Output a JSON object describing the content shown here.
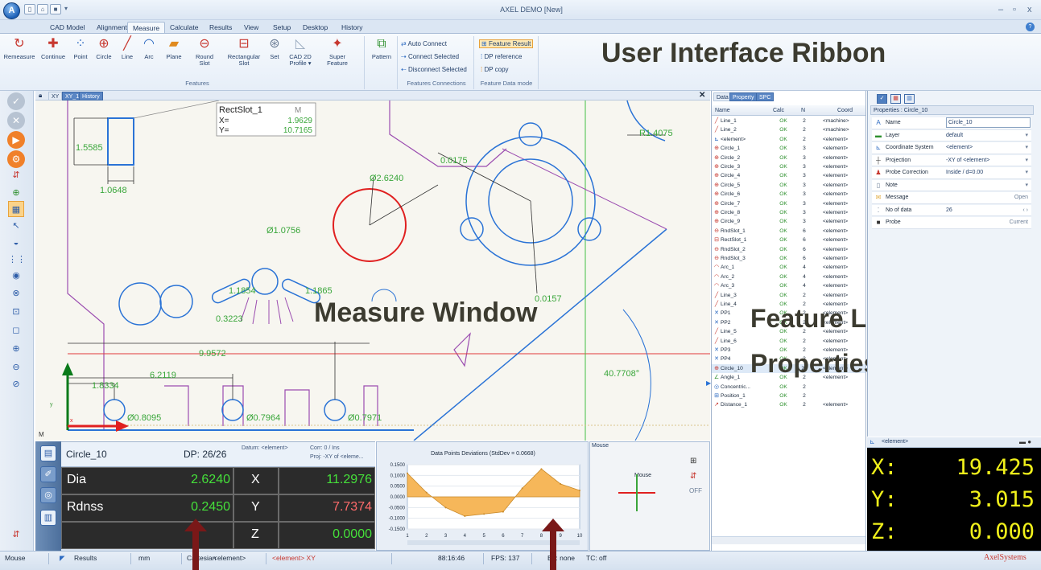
{
  "window": {
    "title": "AXEL DEMO [New]",
    "minimize": "–",
    "restore": "▫",
    "close": "x"
  },
  "quick_access": {
    "new": "▯",
    "open": "⌂",
    "save": "■",
    "dropdown": "▾"
  },
  "app_button": "A",
  "tabs": [
    "CAD Model",
    "Alignment",
    "Measure",
    "Calculate",
    "Results",
    "View",
    "Setup",
    "Desktop",
    "History"
  ],
  "active_tab": "Measure",
  "ribbon": {
    "buttons": [
      {
        "label": "Remeasure",
        "icon": "remeasure-icon",
        "glyph": "↻"
      },
      {
        "label": "Continue",
        "icon": "continue-icon",
        "glyph": "✚"
      },
      {
        "label": "Point",
        "icon": "point-icon",
        "glyph": "⁘"
      },
      {
        "label": "Circle",
        "icon": "circle-icon",
        "glyph": "⊕"
      },
      {
        "label": "Line",
        "icon": "line-icon",
        "glyph": "╱"
      },
      {
        "label": "Arc",
        "icon": "arc-icon",
        "glyph": "◠"
      },
      {
        "label": "Plane",
        "icon": "plane-icon",
        "glyph": "▰"
      },
      {
        "label": "Round\nSlot",
        "icon": "round-slot-icon",
        "glyph": "⊖"
      },
      {
        "label": "Rectangular\nSlot",
        "icon": "rect-slot-icon",
        "glyph": "⊟"
      },
      {
        "label": "Set",
        "icon": "set-icon",
        "glyph": "⊛"
      },
      {
        "label": "CAD 2D\nProfile ▾",
        "icon": "cad-profile-icon",
        "glyph": "◺"
      },
      {
        "label": "Super\nFeature",
        "icon": "super-feature-icon",
        "glyph": "✦"
      },
      {
        "label": "Pattern",
        "icon": "pattern-icon",
        "glyph": "⧉"
      }
    ],
    "group_features": "Features",
    "connections": [
      "Auto Connect",
      "Connect Selected",
      "Disconnect Selected"
    ],
    "group_connections": "Features Connections",
    "data_mode": [
      "Feature Result",
      "DP reference",
      "DP copy"
    ],
    "group_data_mode": "Feature Data mode",
    "help": "?"
  },
  "annotations": {
    "ribbon": "User Interface Ribbon",
    "measure": "Measure Window",
    "feature_list_1": "Feature List &",
    "feature_list_2": "Properties Dialog"
  },
  "measure_tabs": [
    "XY",
    "XY_1",
    "History"
  ],
  "measure_close": "✕",
  "canvas": {
    "tooltip_name": "RectSlot_1",
    "tooltip_flag": "M",
    "tooltip_x_label": "X=",
    "tooltip_x": "1.9629",
    "tooltip_y_label": "Y=",
    "tooltip_y": "10.7165",
    "dims": [
      "1.5585",
      "1.0648",
      "Ø2.6240",
      "Ø1.0756",
      "1.1854",
      "1.1865",
      "0.3223",
      "9.9572",
      "6.2119",
      "1.8334",
      "Ø0.8095",
      "Ø0.7964",
      "Ø0.7971",
      "R1.4075",
      "0.0175",
      "0.0157",
      "40.7708°"
    ],
    "axis_y": "y",
    "axis_x": "x",
    "corner": "M"
  },
  "results": {
    "feature": "Circle_10",
    "dp": "DP: 26/26",
    "datum": "Datum: <element>",
    "corr": "Corr: 0 / Ins",
    "proj": "Proj: -XY of <eleme...",
    "rows": [
      {
        "label": "Dia",
        "value": "2.6240",
        "axis": "X",
        "coord": "11.2976"
      },
      {
        "label": "Rdnss",
        "value": "0.2450",
        "axis": "Y",
        "coord": "7.7374"
      },
      {
        "label": "",
        "value": "",
        "axis": "Z",
        "coord": "0.0000"
      }
    ]
  },
  "chart_data": {
    "type": "area",
    "title": "Data Points Deviations (StdDev = 0.0668)",
    "x": [
      1,
      2,
      3,
      4,
      5,
      6,
      7,
      8,
      9,
      10
    ],
    "series": [
      {
        "values": [
          0.11,
          0.02,
          -0.05,
          -0.09,
          -0.08,
          -0.07,
          0.04,
          0.13,
          0.06,
          0.03
        ]
      }
    ],
    "ylim": [
      -0.15,
      0.15
    ],
    "yticks": [
      "0.1500",
      "0.1000",
      "0.0500",
      "0.0000",
      "-0.0500",
      "-0.1000",
      "-0.1500"
    ],
    "xticks": [
      "1",
      "2",
      "3",
      "4",
      "5",
      "6",
      "7",
      "8",
      "9",
      "10"
    ],
    "color": "#f6b75a",
    "grid": true
  },
  "mouse_panel": {
    "title": "Mouse",
    "label": "Mouse",
    "off": "OFF"
  },
  "feature_list": {
    "tabs": [
      "Data",
      "Property",
      "SPC"
    ],
    "headers": [
      "Name",
      "Calc",
      "N",
      "Coord"
    ],
    "rows": [
      {
        "icon": "line",
        "name": "Line_1",
        "calc": "OK",
        "n": "2",
        "coord": "<machine>"
      },
      {
        "icon": "line",
        "name": "Line_2",
        "calc": "OK",
        "n": "2",
        "coord": "<machine>"
      },
      {
        "icon": "element",
        "name": "<element>",
        "calc": "OK",
        "n": "2",
        "coord": "<element>"
      },
      {
        "icon": "circle",
        "name": "Circle_1",
        "calc": "OK",
        "n": "3",
        "coord": "<element>"
      },
      {
        "icon": "circle",
        "name": "Circle_2",
        "calc": "OK",
        "n": "3",
        "coord": "<element>"
      },
      {
        "icon": "circle",
        "name": "Circle_3",
        "calc": "OK",
        "n": "3",
        "coord": "<element>"
      },
      {
        "icon": "circle",
        "name": "Circle_4",
        "calc": "OK",
        "n": "3",
        "coord": "<element>"
      },
      {
        "icon": "circle",
        "name": "Circle_5",
        "calc": "OK",
        "n": "3",
        "coord": "<element>"
      },
      {
        "icon": "circle",
        "name": "Circle_6",
        "calc": "OK",
        "n": "3",
        "coord": "<element>"
      },
      {
        "icon": "circle",
        "name": "Circle_7",
        "calc": "OK",
        "n": "3",
        "coord": "<element>"
      },
      {
        "icon": "circle",
        "name": "Circle_8",
        "calc": "OK",
        "n": "3",
        "coord": "<element>"
      },
      {
        "icon": "circle",
        "name": "Circle_9",
        "calc": "OK",
        "n": "3",
        "coord": "<element>"
      },
      {
        "icon": "slot",
        "name": "RndSlot_1",
        "calc": "OK",
        "n": "6",
        "coord": "<element>"
      },
      {
        "icon": "rslot",
        "name": "RectSlot_1",
        "calc": "OK",
        "n": "6",
        "coord": "<element>"
      },
      {
        "icon": "slot",
        "name": "RndSlot_2",
        "calc": "OK",
        "n": "6",
        "coord": "<element>"
      },
      {
        "icon": "slot",
        "name": "RndSlot_3",
        "calc": "OK",
        "n": "6",
        "coord": "<element>"
      },
      {
        "icon": "arc",
        "name": "Arc_1",
        "calc": "OK",
        "n": "4",
        "coord": "<element>"
      },
      {
        "icon": "arc",
        "name": "Arc_2",
        "calc": "OK",
        "n": "4",
        "coord": "<element>"
      },
      {
        "icon": "arc",
        "name": "Arc_3",
        "calc": "OK",
        "n": "4",
        "coord": "<element>"
      },
      {
        "icon": "line",
        "name": "Line_3",
        "calc": "OK",
        "n": "2",
        "coord": "<element>"
      },
      {
        "icon": "line",
        "name": "Line_4",
        "calc": "OK",
        "n": "2",
        "coord": "<element>"
      },
      {
        "icon": "pp",
        "name": "PP1",
        "calc": "OK",
        "n": "2",
        "coord": "<element>"
      },
      {
        "icon": "pp",
        "name": "PP2",
        "calc": "OK",
        "n": "2",
        "coord": "<element>"
      },
      {
        "icon": "line",
        "name": "Line_5",
        "calc": "OK",
        "n": "2",
        "coord": "<element>"
      },
      {
        "icon": "line",
        "name": "Line_6",
        "calc": "OK",
        "n": "2",
        "coord": "<element>"
      },
      {
        "icon": "pp",
        "name": "PP3",
        "calc": "OK",
        "n": "2",
        "coord": "<element>"
      },
      {
        "icon": "pp",
        "name": "PP4",
        "calc": "OK",
        "n": "2",
        "coord": "<element>"
      },
      {
        "icon": "circle",
        "name": "Circle_10",
        "calc": "OK",
        "n": "26",
        "coord": "<element>"
      },
      {
        "icon": "angle",
        "name": "Angle_1",
        "calc": "OK",
        "n": "2",
        "coord": "<element>"
      },
      {
        "icon": "conc",
        "name": "Concentric...",
        "calc": "OK",
        "n": "2",
        "coord": ""
      },
      {
        "icon": "pos",
        "name": "Position_1",
        "calc": "OK",
        "n": "2",
        "coord": ""
      },
      {
        "icon": "dist",
        "name": "Distance_1",
        "calc": "OK",
        "n": "2",
        "coord": "<element>"
      }
    ]
  },
  "properties": {
    "title": "Properties : Circle_10",
    "rows": [
      {
        "key": "Name",
        "value": "Circle_10",
        "right": ""
      },
      {
        "key": "Layer",
        "value": "default",
        "right": "▾"
      },
      {
        "key": "Coordinate System",
        "value": "<element>",
        "right": "▾"
      },
      {
        "key": "Projection",
        "value": "-XY of <element>",
        "right": "▾"
      },
      {
        "key": "Probe Correction",
        "value": "Inside / d=0.00",
        "right": "▾"
      },
      {
        "key": "Note",
        "value": "",
        "right": "▾"
      },
      {
        "key": "Message",
        "value": "",
        "right": "Open"
      },
      {
        "key": "No of data",
        "value": "26",
        "right": "‹ ›"
      },
      {
        "key": "Probe",
        "value": "",
        "right": "Current"
      }
    ],
    "dro_title": "<element>",
    "dro": [
      {
        "axis": "X:",
        "value": "19.425"
      },
      {
        "axis": "Y:",
        "value": "3.015"
      },
      {
        "axis": "Z:",
        "value": "0.000"
      }
    ]
  },
  "status": {
    "mode": "Mouse",
    "results": "Results",
    "units": "mm",
    "coord": "Cartesian",
    "element": "<element>",
    "proj": "<element> XY",
    "time": "88:16:46",
    "fps": "FPS: 137",
    "bl": "BL: none",
    "tc": "TC: off",
    "brand": "AxelSystems"
  }
}
